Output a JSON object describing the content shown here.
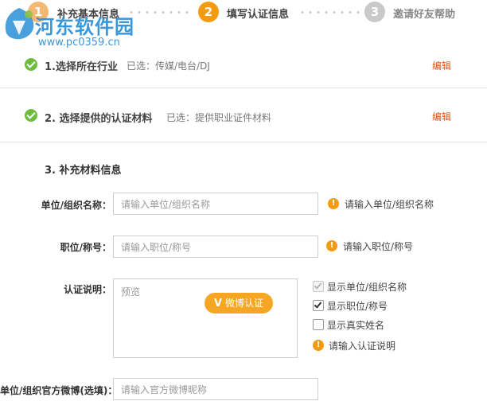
{
  "steps": [
    {
      "number": "1",
      "label": "补充基本信息",
      "color": "#f3b873"
    },
    {
      "number": "2",
      "label": "填写认证信息",
      "color": "#f39c12"
    },
    {
      "number": "3",
      "label": "邀请好友帮助",
      "color": "#c9c9c9"
    }
  ],
  "watermark": {
    "name": "河东软件园",
    "url": "www.pc0359.cn"
  },
  "sections": [
    {
      "title": "1.选择所在行业",
      "selected": "已选：传媒/电台/DJ",
      "edit": "编辑"
    },
    {
      "title": "2. 选择提供的认证材料",
      "selected": "已选：提供职业证件材料",
      "edit": "编辑"
    }
  ],
  "form": {
    "title": "3. 补充材料信息",
    "org_name": {
      "label": "单位/组织名称：",
      "placeholder": "请输入单位/组织名称",
      "warning": "请输入单位/组织名称"
    },
    "position": {
      "label": "职位/称号：",
      "placeholder": "请输入职位/称号",
      "warning": "请输入职位/称号"
    },
    "description": {
      "label": "认证说明：",
      "placeholder": "预览",
      "weibo_button": "微博认证",
      "options": [
        {
          "label": "显示单位/组织名称",
          "checked": true,
          "disabled": true
        },
        {
          "label": "显示职位/称号",
          "checked": true,
          "disabled": false
        },
        {
          "label": "显示真实姓名",
          "checked": false,
          "disabled": false
        }
      ],
      "warning": "请输入认证说明"
    },
    "official_weibo": {
      "label": "单位/组织官方微博(选填)：",
      "placeholder": "请输入官方微博昵称"
    }
  }
}
